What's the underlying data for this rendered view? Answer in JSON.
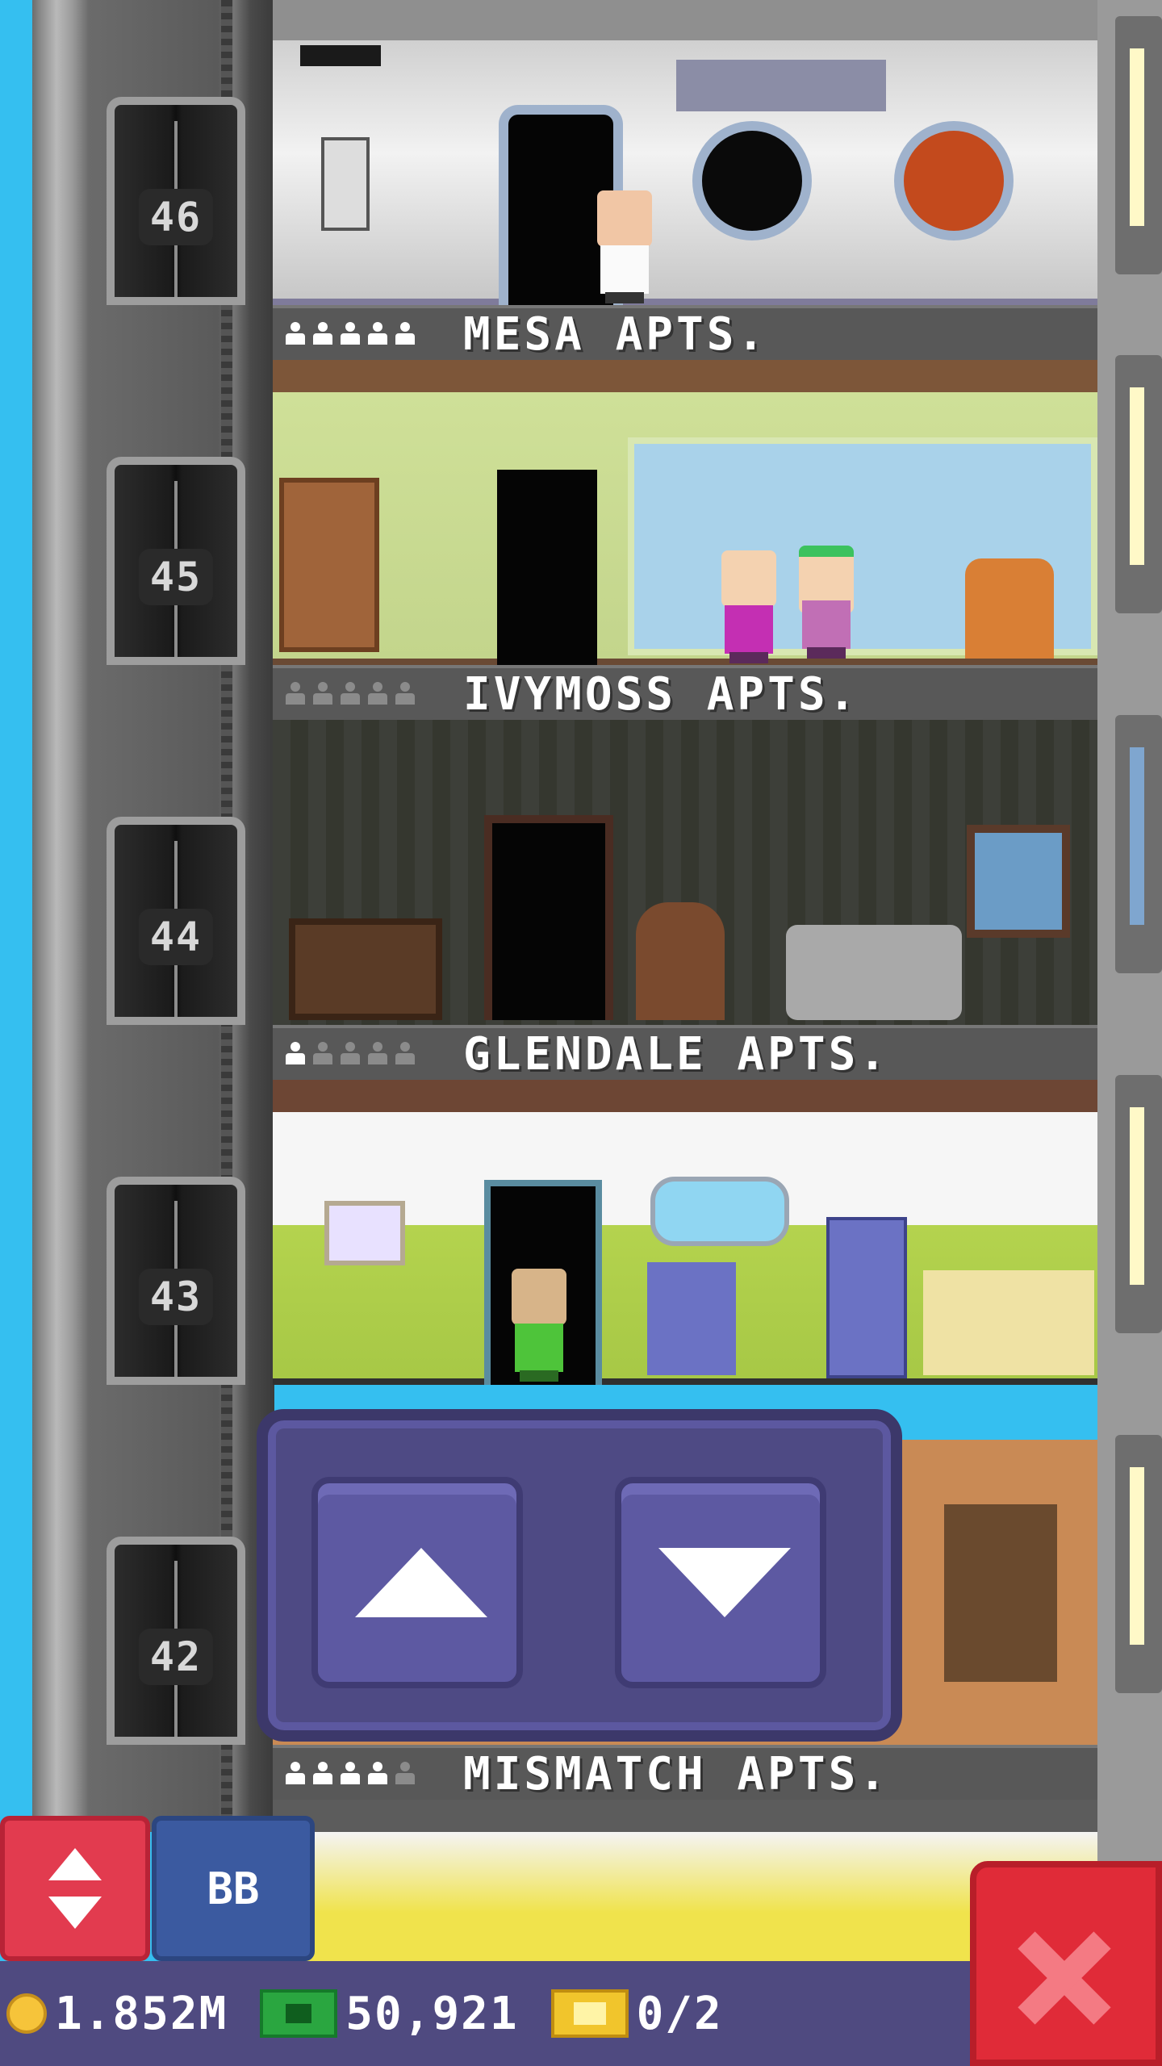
{
  "floors": [
    {
      "number": "46",
      "name": "MESA APTS.",
      "occupancy": [
        1,
        1,
        1,
        1,
        1
      ]
    },
    {
      "number": "45",
      "name": "IVYMOSS APTS.",
      "occupancy": [
        0,
        0,
        0,
        0,
        0
      ]
    },
    {
      "number": "44",
      "name": "GLENDALE APTS.",
      "occupancy": [
        1,
        0,
        0,
        0,
        0
      ]
    },
    {
      "number": "43",
      "name": "",
      "occupancy": []
    },
    {
      "number": "42",
      "name": "MISMATCH APTS.",
      "occupancy": [
        1,
        1,
        1,
        1,
        0
      ]
    }
  ],
  "controls": {
    "bb_label": "BB",
    "elevator_button_icon": "elevator-arrows-icon",
    "close_icon": "close-icon"
  },
  "status": {
    "coins": "1.852M",
    "bux": "50,921",
    "tickets": "0/2"
  },
  "colors": {
    "sky": "#35bff0",
    "panel": "#4e4a84",
    "close": "#e02b38",
    "elevator_button": "#e23b4f",
    "bb_button": "#3b5aa0"
  }
}
